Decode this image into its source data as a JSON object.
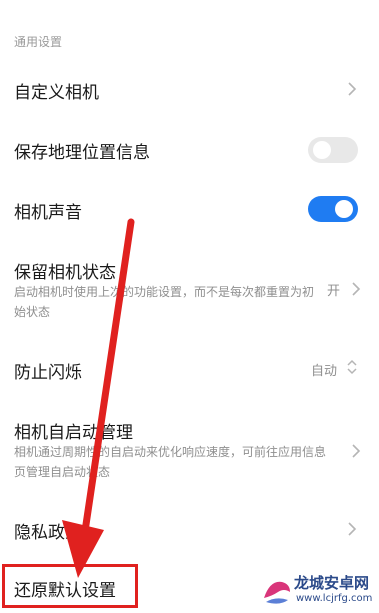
{
  "section": {
    "label": "通用设置"
  },
  "rows": {
    "custom_camera": {
      "title": "自定义相机",
      "icon": "chevron-right-icon"
    },
    "save_location": {
      "title": "保存地理位置信息",
      "toggle_on": false
    },
    "camera_sound": {
      "title": "相机声音",
      "toggle_on": true
    },
    "keep_state": {
      "title": "保留相机状态",
      "description": "启动相机时使用上次的功能设置，而不是每次都重置为初始状态",
      "value": "开",
      "icon": "chevron-right-icon"
    },
    "anti_flicker": {
      "title": "防止闪烁",
      "value": "自动",
      "icon": "chevron-up-down-icon"
    },
    "auto_start": {
      "title": "相机自启动管理",
      "description": "相机通过周期性的自启动来优化响应速度，可前往应用信息页管理自启动状态",
      "icon": "chevron-right-icon"
    },
    "privacy": {
      "title": "隐私政策",
      "icon": "chevron-right-icon"
    },
    "reset": {
      "title": "还原默认设置"
    }
  },
  "watermark": {
    "title": "龙城安卓网",
    "url": "www.lcjrfg.com"
  },
  "colors": {
    "toggle_on": "#1f7cf2",
    "toggle_off": "#e8e8e8",
    "annotation_red": "#e0211f"
  }
}
